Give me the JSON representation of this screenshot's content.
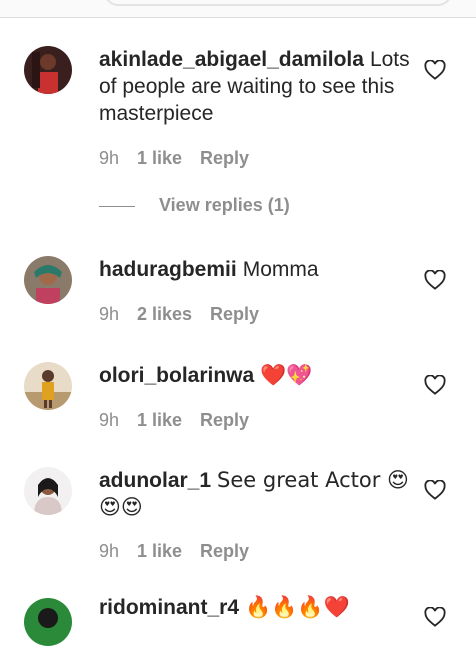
{
  "comments": [
    {
      "username": "akinlade_abigael_damilola",
      "text": "Lots of people are waiting to see this masterpiece",
      "time": "9h",
      "likes": "1 like",
      "reply": "Reply"
    },
    {
      "username": "haduragbemii",
      "text": "Momma",
      "time": "9h",
      "likes": "2 likes",
      "reply": "Reply"
    },
    {
      "username": "olori_bolarinwa",
      "text": "❤️💖",
      "time": "9h",
      "likes": "1 like",
      "reply": "Reply"
    },
    {
      "username": "adunolar_1",
      "text": "See great Actor 😍😍😍",
      "time": "9h",
      "likes": "1 like",
      "reply": "Reply"
    },
    {
      "username": "ridominant_r4",
      "text": "🔥🔥🔥❤️",
      "time": "",
      "likes": "",
      "reply": ""
    }
  ],
  "view_replies": "View replies (1)",
  "icons": {
    "like": "heart-outline-icon"
  },
  "colors": {
    "text": "#262626",
    "secondary": "#8e8e8e",
    "emoji_red": "#e0245e"
  }
}
